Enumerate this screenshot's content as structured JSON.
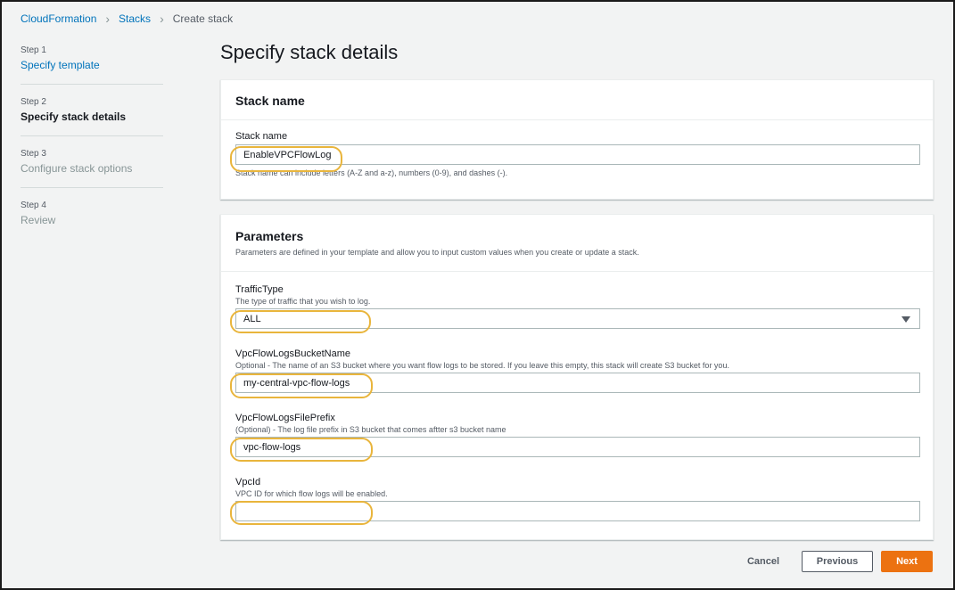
{
  "breadcrumb": {
    "items": [
      "CloudFormation",
      "Stacks",
      "Create stack"
    ]
  },
  "steps": [
    {
      "num": "Step 1",
      "label": "Specify template",
      "state": "link"
    },
    {
      "num": "Step 2",
      "label": "Specify stack details",
      "state": "active"
    },
    {
      "num": "Step 3",
      "label": "Configure stack options",
      "state": "disabled"
    },
    {
      "num": "Step 4",
      "label": "Review",
      "state": "disabled"
    }
  ],
  "page_title": "Specify stack details",
  "stack_name_panel": {
    "title": "Stack name",
    "field_label": "Stack name",
    "value": "EnableVPCFlowLog",
    "hint": "Stack name can include letters (A-Z and a-z), numbers (0-9), and dashes (-)."
  },
  "parameters_panel": {
    "title": "Parameters",
    "description": "Parameters are defined in your template and allow you to input custom values when you create or update a stack.",
    "fields": [
      {
        "label": "TrafficType",
        "desc": "The type of traffic that you wish to log.",
        "value": "ALL",
        "type": "select"
      },
      {
        "label": "VpcFlowLogsBucketName",
        "desc": "Optional - The name of an S3 bucket where you want flow logs to be stored. If you leave this empty, this stack will create S3 bucket for you.",
        "value": "my-central-vpc-flow-logs",
        "type": "text"
      },
      {
        "label": "VpcFlowLogsFilePrefix",
        "desc": "(Optional) - The log file prefix in S3 bucket that comes aftter s3 bucket name",
        "value": "vpc-flow-logs",
        "type": "text"
      },
      {
        "label": "VpcId",
        "desc": "VPC ID for which flow logs will be enabled.",
        "value": "",
        "type": "text"
      }
    ]
  },
  "footer": {
    "cancel": "Cancel",
    "previous": "Previous",
    "next": "Next"
  },
  "colors": {
    "link": "#0073bb",
    "primary_button": "#ec7211",
    "highlight": "#e9b53c"
  }
}
